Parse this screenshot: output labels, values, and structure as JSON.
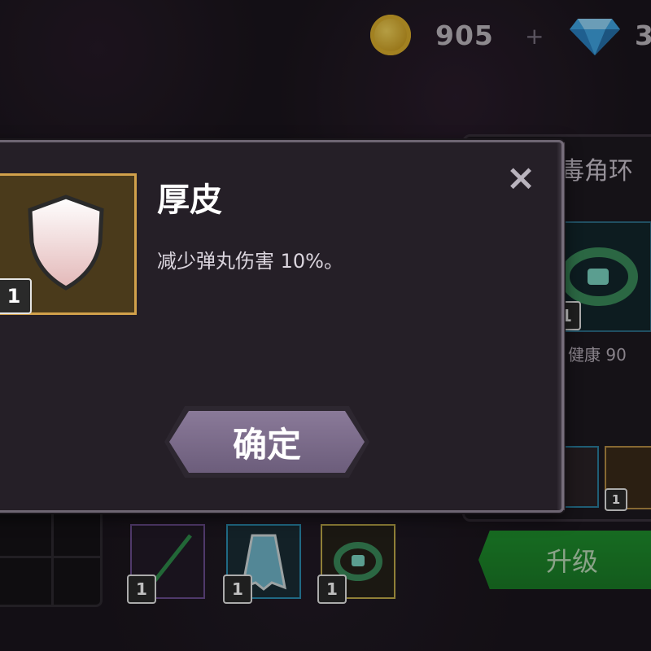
{
  "currency": {
    "coins": "905",
    "plus": "+",
    "gems": "3"
  },
  "item_panel": {
    "title": "毒角环",
    "stat": "健康 90",
    "slot_level": "1",
    "small_slot_level": "1"
  },
  "equipment": [
    {
      "level": "1"
    },
    {
      "level": "1"
    },
    {
      "level": "1"
    }
  ],
  "upgrade_label": "升级",
  "dialog": {
    "skill_name": "厚皮",
    "skill_desc": "减少弹丸伤害 10%。",
    "skill_level": "1",
    "close": "×",
    "confirm": "确定"
  },
  "colors": {
    "coin": "#d9ad2c",
    "upgrade_green": "#1f8f2d",
    "skill_frame": "#d2a14b"
  }
}
